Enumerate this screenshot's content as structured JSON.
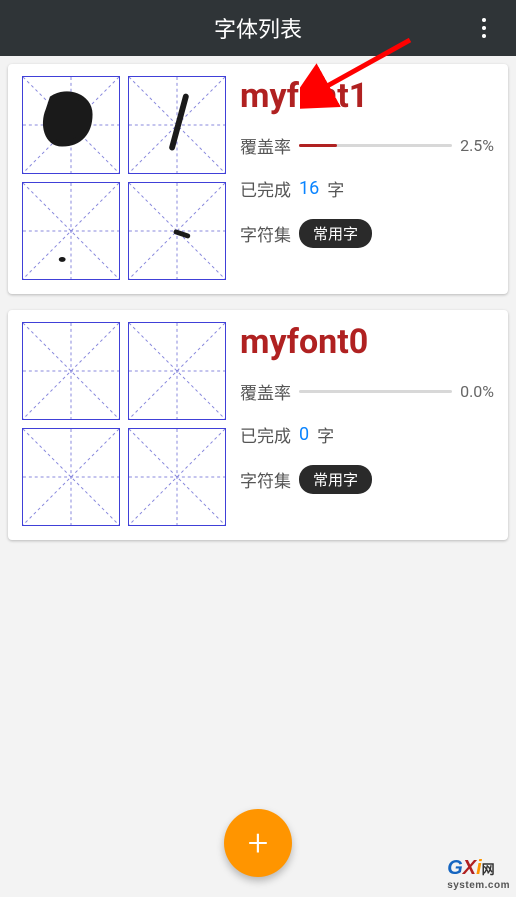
{
  "toolbar": {
    "title": "字体列表"
  },
  "fonts": [
    {
      "name": "myfont1",
      "coverage_label": "覆盖率",
      "coverage_pct_text": "2.5%",
      "coverage_pct": 2.5,
      "completed_label": "已完成",
      "completed_count": "16",
      "completed_unit": "字",
      "charset_label": "字符集",
      "charset_value": "常用字",
      "glyphs": [
        "circle",
        "slash",
        "dot",
        "dash"
      ]
    },
    {
      "name": "myfont0",
      "coverage_label": "覆盖率",
      "coverage_pct_text": "0.0%",
      "coverage_pct": 0.0,
      "completed_label": "已完成",
      "completed_count": "0",
      "completed_unit": "字",
      "charset_label": "字符集",
      "charset_value": "常用字",
      "glyphs": [
        "none",
        "none",
        "none",
        "none"
      ]
    }
  ],
  "watermark": {
    "brand_g": "G",
    "brand_x": "X",
    "brand_i": "i",
    "brand_suffix": "网",
    "domain": "system.com"
  },
  "colors": {
    "accent": "#b02121",
    "fab": "#ff9500",
    "link": "#0a84ff",
    "toolbar": "#2f3437"
  }
}
